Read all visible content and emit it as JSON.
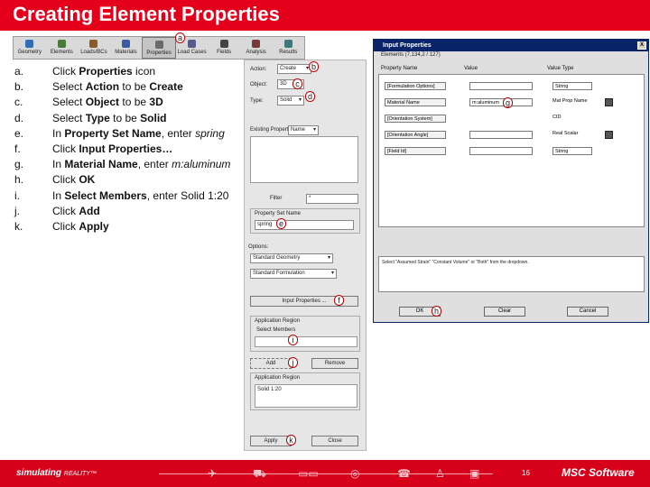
{
  "slide": {
    "title": "Creating Element Properties"
  },
  "toolbar": {
    "items": [
      {
        "label": "Geometry",
        "color": "#2f6db5"
      },
      {
        "label": "Elements",
        "color": "#4a7a3a"
      },
      {
        "label": "Loads/BCs",
        "color": "#8a5a2a"
      },
      {
        "label": "Materials",
        "color": "#3a5aa5"
      },
      {
        "label": "Properties",
        "color": "#6a6a6a"
      },
      {
        "label": "Load Cases",
        "color": "#5a5a8a"
      },
      {
        "label": "Fields",
        "color": "#444444"
      },
      {
        "label": "Analysis",
        "color": "#7a3a3a"
      },
      {
        "label": "Results",
        "color": "#3a7a7a"
      }
    ]
  },
  "steps": [
    {
      "letter": "a.",
      "parts": [
        {
          "t": "Click "
        },
        {
          "t": "Properties",
          "b": true
        },
        {
          "t": " icon"
        }
      ]
    },
    {
      "letter": "b.",
      "parts": [
        {
          "t": "Select "
        },
        {
          "t": "Action",
          "b": true
        },
        {
          "t": " to be "
        },
        {
          "t": "Create",
          "b": true
        }
      ]
    },
    {
      "letter": "c.",
      "parts": [
        {
          "t": "Select "
        },
        {
          "t": "Object",
          "b": true
        },
        {
          "t": " to be "
        },
        {
          "t": "3D",
          "b": true
        }
      ]
    },
    {
      "letter": "d.",
      "parts": [
        {
          "t": "Select "
        },
        {
          "t": "Type",
          "b": true
        },
        {
          "t": " to be "
        },
        {
          "t": "Solid",
          "b": true
        }
      ]
    },
    {
      "letter": "e.",
      "parts": [
        {
          "t": "In "
        },
        {
          "t": "Property Set Name",
          "b": true
        },
        {
          "t": ", enter "
        },
        {
          "t": "spring",
          "i": true
        }
      ]
    },
    {
      "letter": "f.",
      "parts": [
        {
          "t": "Click "
        },
        {
          "t": "Input Properties…",
          "b": true
        }
      ]
    },
    {
      "letter": "g.",
      "parts": [
        {
          "t": "In "
        },
        {
          "t": "Material Name",
          "b": true
        },
        {
          "t": ", enter "
        },
        {
          "t": "m:aluminum",
          "i": true
        }
      ]
    },
    {
      "letter": "h.",
      "parts": [
        {
          "t": "Click "
        },
        {
          "t": "OK",
          "b": true
        }
      ]
    },
    {
      "letter": "i.",
      "parts": [
        {
          "t": "In "
        },
        {
          "t": "Select Members",
          "b": true
        },
        {
          "t": ", enter Solid 1:20"
        }
      ]
    },
    {
      "letter": "j.",
      "parts": [
        {
          "t": "Click "
        },
        {
          "t": "Add",
          "b": true
        }
      ]
    },
    {
      "letter": "k.",
      "parts": [
        {
          "t": "Click "
        },
        {
          "t": "Apply",
          "b": true
        }
      ]
    }
  ],
  "panel": {
    "action_label": "Action:",
    "action_value": "Create",
    "object_label": "Object:",
    "object_value": "3D",
    "type_label": "Type:",
    "type_value": "Solid",
    "existing_sets_label": "Existing Property Sets",
    "existing_sets_value": "Name",
    "filter_label": "Filter",
    "filter_value": "*",
    "set_name_label": "Property Set Name",
    "set_name_value": "spring",
    "options_label": "Options:",
    "option1": "Standard Geometry",
    "option2": "Standard Formulation",
    "input_properties_button": "Input Properties ...",
    "app_region_label": "Application Region",
    "select_members_label": "Select Members",
    "add_button": "Add",
    "remove_button": "Remove",
    "app_region2_label": "Application Region",
    "app_region_value": "Solid 1:20",
    "apply_button": "Apply",
    "close_button": "Close"
  },
  "dialog": {
    "title": "Input Properties",
    "close_glyph": "X",
    "elements_line": "Elements (7,134,2 / 127)",
    "col_name": "Property Name",
    "col_value": "Value",
    "col_type": "Value Type",
    "rows": [
      {
        "name": "[Formulation Options]",
        "value": "",
        "type": "String",
        "kind": "combo"
      },
      {
        "name": "Material Name",
        "value": "m:aluminum",
        "type": "Mat Prop Name",
        "kind": "icon"
      },
      {
        "name": "[Orientation System]",
        "value": "",
        "type": "CID",
        "kind": "text"
      },
      {
        "name": "[Orientation Angle]",
        "value": "",
        "type": "Real Scalar",
        "kind": "icon"
      },
      {
        "name": "[Field Id]",
        "value": "",
        "type": "String",
        "kind": "combo"
      }
    ],
    "message": "Select \"Assumed Strain\" \"Constant Volume\" or \"Both\" from the dropdown.",
    "ok_button": "OK",
    "clear_button": "Clear",
    "cancel_button": "Cancel"
  },
  "callouts": {
    "a": "a",
    "b": "b",
    "c": "c",
    "d": "d",
    "e": "e",
    "f": "f",
    "g": "g",
    "h": "h",
    "i": "i",
    "j": "j",
    "k": "k"
  },
  "footer": {
    "brand": "simulating",
    "brand_reality": "REALITY™",
    "page_number": "16",
    "logo": "MSC Software"
  }
}
